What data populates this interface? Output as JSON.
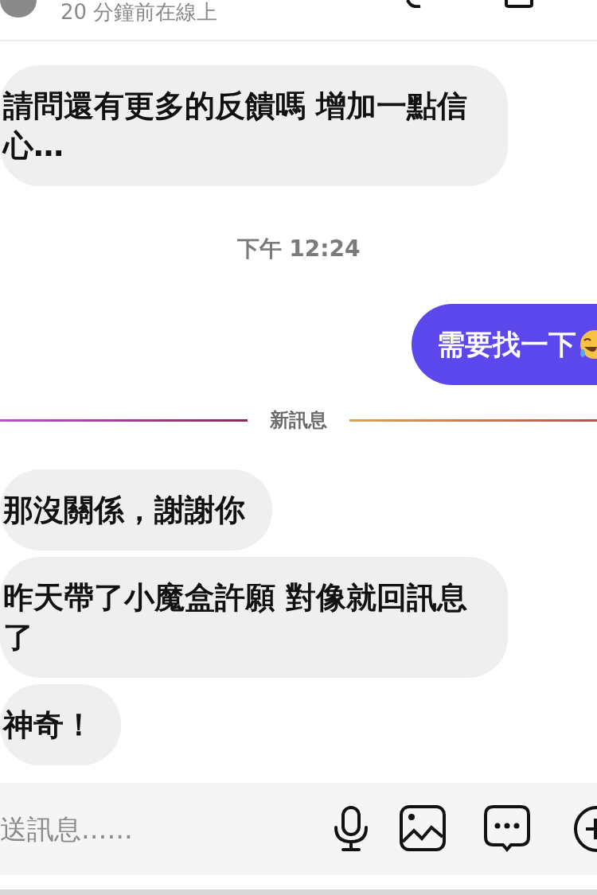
{
  "header": {
    "status": "20 分鐘前在線上"
  },
  "messages": [
    {
      "kind": "received",
      "text": "請問還有更多的反饋嗎 增加一點信心…"
    },
    {
      "kind": "time",
      "text": "下午 12:24"
    },
    {
      "kind": "sent",
      "text": "需要找一下"
    },
    {
      "kind": "divider",
      "text": "新訊息"
    },
    {
      "kind": "received",
      "text": "那沒關係，謝謝你"
    },
    {
      "kind": "received",
      "text": "昨天帶了小魔盒許願 對像就回訊息了"
    },
    {
      "kind": "received",
      "text": "神奇！"
    }
  ],
  "composer": {
    "placeholder": "送訊息......"
  }
}
